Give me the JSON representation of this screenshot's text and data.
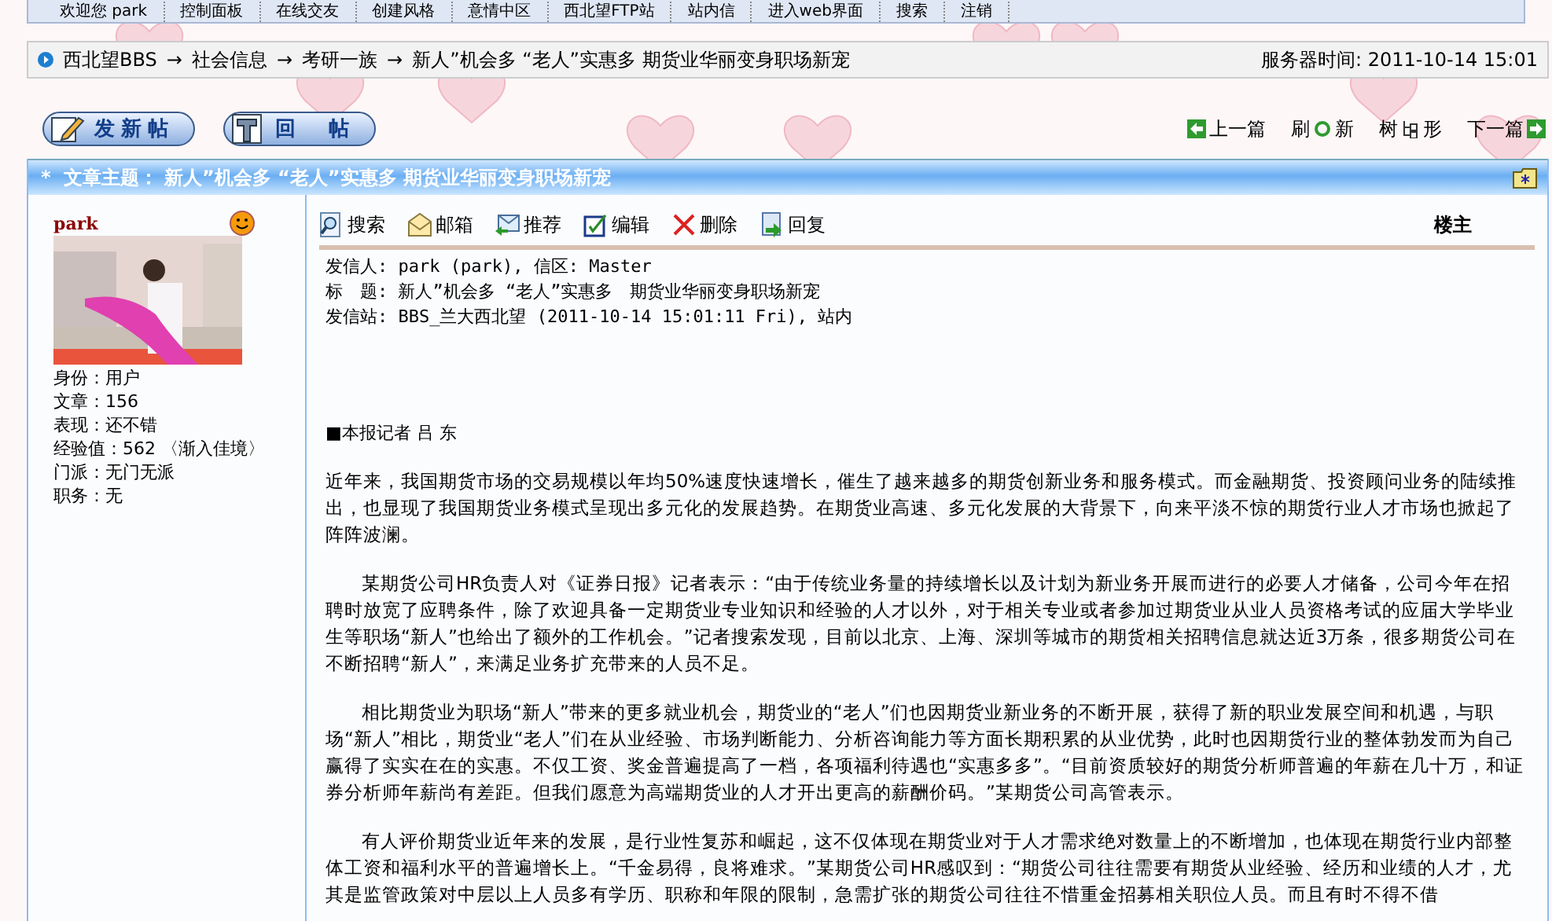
{
  "top_nav": [
    "欢迎您 park",
    "控制面板",
    "在线交友",
    "创建风格",
    "意情中区",
    "西北望FTP站",
    "站内信",
    "进入web界面",
    "搜索",
    "注销"
  ],
  "breadcrumb": {
    "items": [
      "西北望BBS",
      "社会信息",
      "考研一族",
      "新人”机会多 “老人”实惠多 期货业华丽变身职场新宠"
    ],
    "separator": "→",
    "server_time": "服务器时间: 2011-10-14 15:01"
  },
  "post_buttons": [
    {
      "label": "发新帖",
      "kind": "pencil"
    },
    {
      "label": "回　帖",
      "kind": "tee"
    }
  ],
  "thread_nav": [
    {
      "label": "上一篇",
      "kind": "prev"
    },
    {
      "label": "刷新",
      "kind": "refresh"
    },
    {
      "label": "树形",
      "kind": "tree"
    },
    {
      "label": "下一篇",
      "kind": "next"
    }
  ],
  "topic_bar": {
    "bullet": "*",
    "label": "文章主题：",
    "title": "新人”机会多 “老人”实惠多 期货业华丽变身职场新宠"
  },
  "author": {
    "name": "park",
    "stats": [
      "身份：用户",
      "文章：156",
      "表现：还不错",
      "经验值：562 〈渐入佳境〉",
      "门派：无门无派",
      "职务：无"
    ]
  },
  "actions": [
    {
      "label": "搜索",
      "kind": "search"
    },
    {
      "label": "邮箱",
      "kind": "mail"
    },
    {
      "label": "推荐",
      "kind": "recommend"
    },
    {
      "label": "编辑",
      "kind": "edit"
    },
    {
      "label": "删除",
      "kind": "delete"
    },
    {
      "label": "回复",
      "kind": "reply"
    }
  ],
  "floor": "楼主",
  "header_lines": [
    "发信人: park (park), 信区: Master",
    "标　题: 新人”机会多 “老人”实惠多　期货业华丽变身职场新宠",
    "发信站: BBS_兰大西北望 (2011-10-14 15:01:11 Fri), 站内"
  ],
  "byline": "■本报记者 吕 东",
  "paragraphs": [
    {
      "indent": false,
      "text": "近年来，我国期货市场的交易规模以年均50%速度快速增长，催生了越来越多的期货创新业务和服务模式。而金融期货、投资顾问业务的陆续推出，也显现了我国期货业务模式呈现出多元化的发展趋势。在期货业高速、多元化发展的大背景下，向来平淡不惊的期货行业人才市场也掀起了阵阵波澜。"
    },
    {
      "indent": true,
      "text": "某期货公司HR负责人对《证券日报》记者表示：“由于传统业务量的持续增长以及计划为新业务开展而进行的必要人才储备，公司今年在招聘时放宽了应聘条件，除了欢迎具备一定期货业专业知识和经验的人才以外，对于相关专业或者参加过期货业从业人员资格考试的应届大学毕业生等职场“新人”也给出了额外的工作机会。”记者搜索发现，目前以北京、上海、深圳等城市的期货相关招聘信息就达近3万条，很多期货公司在不断招聘“新人”，来满足业务扩充带来的人员不足。"
    },
    {
      "indent": true,
      "text": "相比期货业为职场“新人”带来的更多就业机会，期货业的“老人”们也因期货业新业务的不断开展，获得了新的职业发展空间和机遇，与职场“新人”相比，期货业“老人”们在从业经验、市场判断能力、分析咨询能力等方面长期积累的从业优势，此时也因期货行业的整体勃发而为自己赢得了实实在在的实惠。不仅工资、奖金普遍提高了一档，各项福利待遇也“实惠多多”。“目前资质较好的期货分析师普遍的年薪在几十万，和证券分析师年薪尚有差距。但我们愿意为高端期货业的人才开出更高的薪酬价码。”某期货公司高管表示。"
    },
    {
      "indent": true,
      "text": "有人评价期货业近年来的发展，是行业性复苏和崛起，这不仅体现在期货业对于人才需求绝对数量上的不断增加，也体现在期货行业内部整体工资和福利水平的普遍增长上。“千金易得，良将难求。”某期货公司HR感叹到：“期货公司往往需要有期货从业经验、经历和业绩的人才，尤其是监管政策对中层以上人员多有学历、职称和年限的限制，急需扩张的期货公司往往不惜重金招募相关职位人员。而且有时不得不借"
    }
  ]
}
